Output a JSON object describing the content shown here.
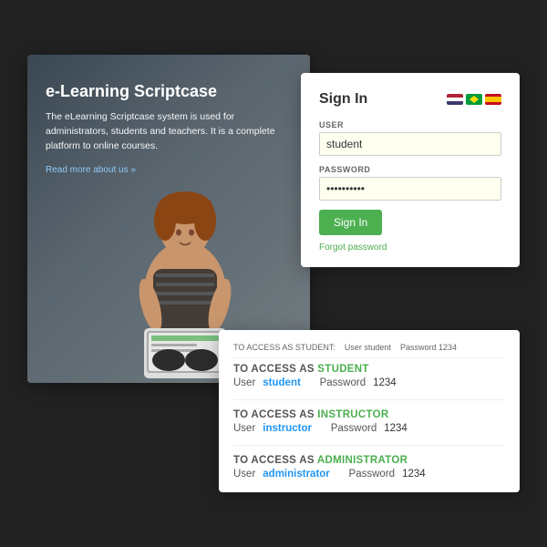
{
  "leftPanel": {
    "title": "e-Learning Scriptcase",
    "description": "The eLearning Scriptcase system is used for administrators, students and teachers. It is a complete platform to online courses.",
    "readMoreLabel": "Read more about us »"
  },
  "signIn": {
    "title": "Sign In",
    "userLabel": "USER",
    "userValue": "student",
    "passwordLabel": "PASSWORD",
    "passwordValue": "••••••••••",
    "signInButtonLabel": "Sign In",
    "forgotPasswordLabel": "Forgot password"
  },
  "infoCard": {
    "tooltipText": "TO ACCESS AS STUDENT:",
    "tooltipUser": "User student",
    "tooltipPass": "Password 1234",
    "sections": [
      {
        "title": "TO ACCESS AS STUDENT",
        "userLabel": "User",
        "username": "student",
        "passwordLabel": "Password",
        "password": "1234"
      },
      {
        "title": "TO ACCESS AS INSTRUCTOR",
        "userLabel": "User",
        "username": "instructor",
        "passwordLabel": "Password",
        "password": "1234"
      },
      {
        "title": "TO ACCESS AS ADMINISTRATOR",
        "userLabel": "User",
        "username": "administrator",
        "passwordLabel": "Password",
        "password": "1234"
      }
    ]
  }
}
